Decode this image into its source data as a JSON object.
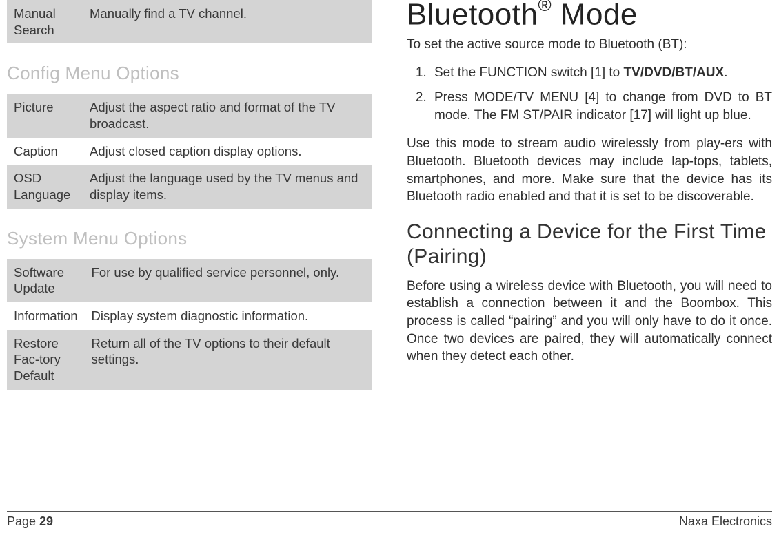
{
  "left": {
    "table1": {
      "rows": [
        {
          "label": "Manual Search",
          "desc": "Manually find a TV channel."
        }
      ]
    },
    "section1_title": "Config Menu Options",
    "table2": {
      "rows": [
        {
          "label": "Picture",
          "desc": "Adjust the aspect ratio and format of the TV broadcast."
        },
        {
          "label": "Caption",
          "desc": "Adjust closed caption display options."
        },
        {
          "label": "OSD Language",
          "desc": "Adjust the language used by the TV menus and display items."
        }
      ]
    },
    "section2_title": "System Menu Options",
    "table3": {
      "rows": [
        {
          "label": "Software Update",
          "desc": "For use by qualified service personnel, only."
        },
        {
          "label": "Information",
          "desc": "Display system diagnostic information."
        },
        {
          "label": "Restore Fac-tory Default",
          "desc": "Return all of the TV options to their default settings."
        }
      ]
    }
  },
  "right": {
    "title_a": "Bluetooth",
    "title_reg": "®",
    "title_b": " Mode",
    "lead": "To set the active source mode to Bluetooth (BT):",
    "steps": {
      "s1a": "Set the FUNCTION switch [1] to ",
      "s1b": "TV/DVD/BT/AUX",
      "s1c": ".",
      "s2": "Press MODE/TV MENU [4] to change from DVD to BT mode. The FM ST/PAIR indicator [17] will light up blue."
    },
    "para1": "Use this mode to stream audio wirelessly from play-ers with Bluetooth. Bluetooth devices may include lap-tops, tablets, smartphones, and more. Make sure that the device has its Bluetooth radio enabled and that it is set to be discoverable.",
    "sub_title": "Connecting a Device for the First Time (Pairing)",
    "para2": "Before using a wireless device with Bluetooth, you will need to establish a connection between it and the Boombox. This process is called “pairing” and you will only have to do it once. Once two devices are paired, they will automatically connect when they detect each other."
  },
  "footer": {
    "page_label": "Page ",
    "page_num": "29",
    "brand": "Naxa Electronics"
  }
}
